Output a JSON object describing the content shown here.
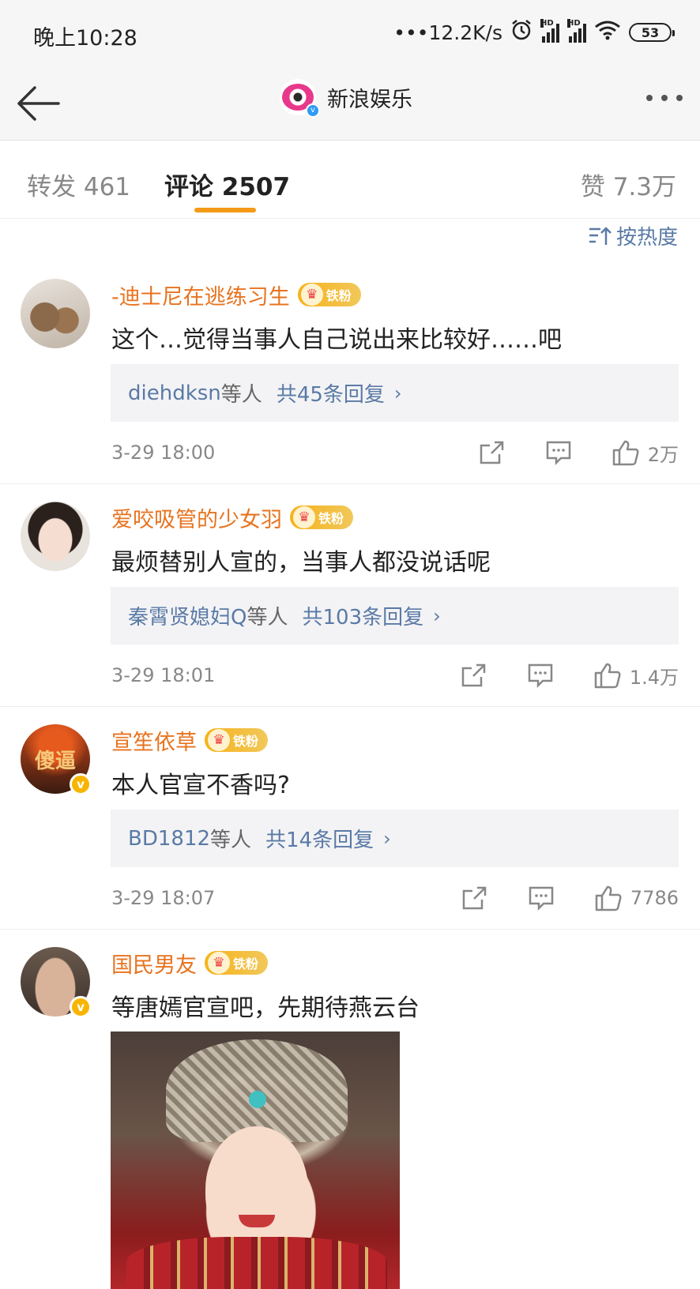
{
  "status_bar": {
    "time": "晚上10:28",
    "network_speed": "•••12.2K/s",
    "alarm_icon": "alarm-icon",
    "hd_label": "HD",
    "battery": "53"
  },
  "nav": {
    "account_name": "新浪娱乐",
    "back_icon": "arrow-left-icon",
    "more_icon": "more-dots-icon"
  },
  "tabs": {
    "forward": "转发 461",
    "comment": "评论 2507",
    "like": "赞 7.3万"
  },
  "sort": {
    "label": "按热度",
    "icon": "sort-icon"
  },
  "comments": [
    {
      "username": "-迪士尼在逃练习生",
      "badge": "铁粉",
      "text": "这个…觉得当事人自己说出来比较好……吧",
      "reply_users": "diehdksn",
      "reply_etc": "等人",
      "reply_count": "共45条回复",
      "time": "3-29 18:00",
      "likes": "2万"
    },
    {
      "username": "爱咬吸管的少女羽",
      "badge": "铁粉",
      "text": "最烦替别人宣的，当事人都没说话呢",
      "reply_users": "秦霄贤媳妇Q",
      "reply_etc": "等人",
      "reply_count": "共103条回复",
      "time": "3-29 18:01",
      "likes": "1.4万"
    },
    {
      "username": "宣笙依草",
      "badge": "铁粉",
      "avatar_text": "傻逼",
      "text": "本人官宣不香吗?",
      "reply_users": "BD1812",
      "reply_etc": "等人",
      "reply_count": "共14条回复",
      "time": "3-29 18:07",
      "likes": "7786"
    },
    {
      "username": "国民男友",
      "badge": "铁粉",
      "text": "等唐嫣官宣吧，先期待燕云台"
    }
  ],
  "colors": {
    "username": "#e8731e",
    "link_blue": "#5a7aa6",
    "tab_underline": "#f59a16",
    "badge_gold": "#f6b21a"
  }
}
